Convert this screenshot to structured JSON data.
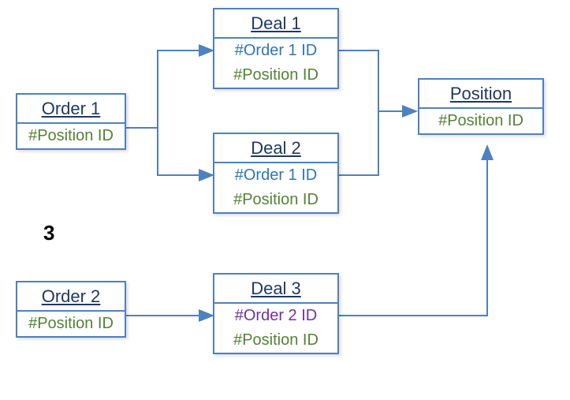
{
  "boxes": {
    "order1": {
      "title": "Order 1",
      "fields": [
        {
          "text": "#Position ID",
          "cls": "posid"
        }
      ]
    },
    "order2": {
      "title": "Order 2",
      "fields": [
        {
          "text": "#Position ID",
          "cls": "posid"
        }
      ]
    },
    "deal1": {
      "title": "Deal 1",
      "fields": [
        {
          "text": "#Order 1 ID",
          "cls": "orderid"
        },
        {
          "text": "#Position ID",
          "cls": "posid"
        }
      ]
    },
    "deal2": {
      "title": "Deal 2",
      "fields": [
        {
          "text": "#Order 1 ID",
          "cls": "orderid"
        },
        {
          "text": "#Position ID",
          "cls": "posid"
        }
      ]
    },
    "deal3": {
      "title": "Deal 3",
      "fields": [
        {
          "text": "#Order 2 ID",
          "cls": "orderid2"
        },
        {
          "text": "#Position ID",
          "cls": "posid"
        }
      ]
    },
    "position": {
      "title": "Position",
      "fields": [
        {
          "text": "#Position ID",
          "cls": "posid"
        }
      ]
    }
  },
  "stray_label": "3"
}
